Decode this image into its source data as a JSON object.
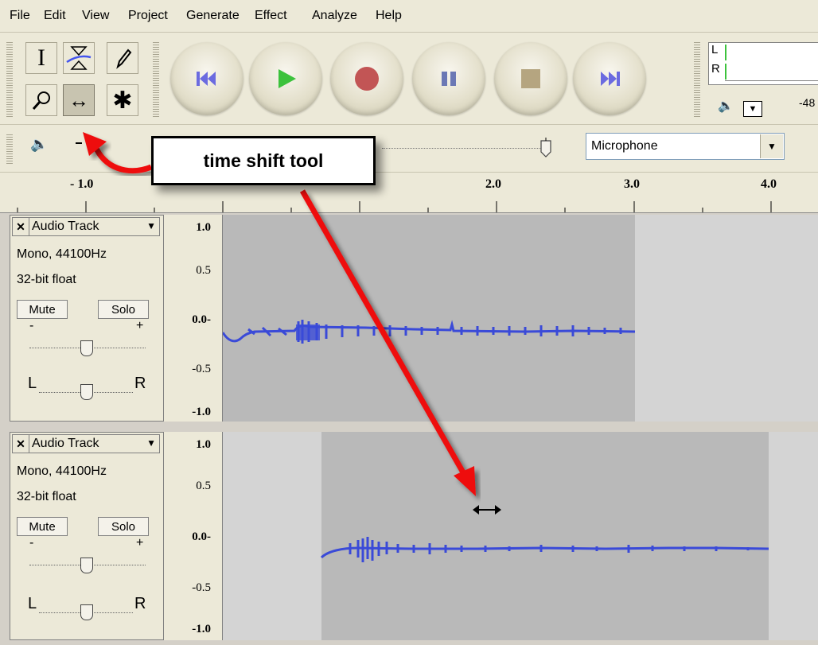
{
  "menu": [
    "File",
    "Edit",
    "View",
    "Project",
    "Generate",
    "Effect",
    "Analyze",
    "Help"
  ],
  "tools": {
    "selection": "I",
    "envelope": "",
    "draw": "",
    "zoom": "",
    "timeshift": "↔",
    "multi": "✱",
    "active": "timeshift"
  },
  "transport": [
    "skip-to-start-icon",
    "play-icon",
    "record-icon",
    "pause-icon",
    "stop-icon",
    "skip-to-end-icon"
  ],
  "meter": {
    "left": "L",
    "right": "R",
    "db_label": "-48"
  },
  "mixer": {
    "input_source": "Microphone"
  },
  "ruler": {
    "labels": [
      "- 1.0",
      "2.0",
      "3.0",
      "4.0"
    ]
  },
  "callout": {
    "text": "time shift tool"
  },
  "tracks": [
    {
      "name": "Audio Track",
      "format": "Mono, 44100Hz",
      "bits": "32-bit float",
      "mute": "Mute",
      "solo": "Solo",
      "gain_minus": "-",
      "gain_plus": "+",
      "pan_left": "L",
      "pan_right": "R",
      "scale": [
        "1.0",
        "0.5",
        "0.0-",
        "-0.5",
        "-1.0"
      ]
    },
    {
      "name": "Audio Track",
      "format": "Mono, 44100Hz",
      "bits": "32-bit float",
      "mute": "Mute",
      "solo": "Solo",
      "gain_minus": "-",
      "gain_plus": "+",
      "pan_left": "L",
      "pan_right": "R",
      "scale": [
        "1.0",
        "0.5",
        "0.0-",
        "-0.5",
        "-1.0"
      ]
    }
  ],
  "colors": {
    "waveform": "#3a4ad8",
    "clip_bg": "#b9b9b9",
    "track_bg": "#d4d4d4",
    "annotation": "#ee1111"
  }
}
